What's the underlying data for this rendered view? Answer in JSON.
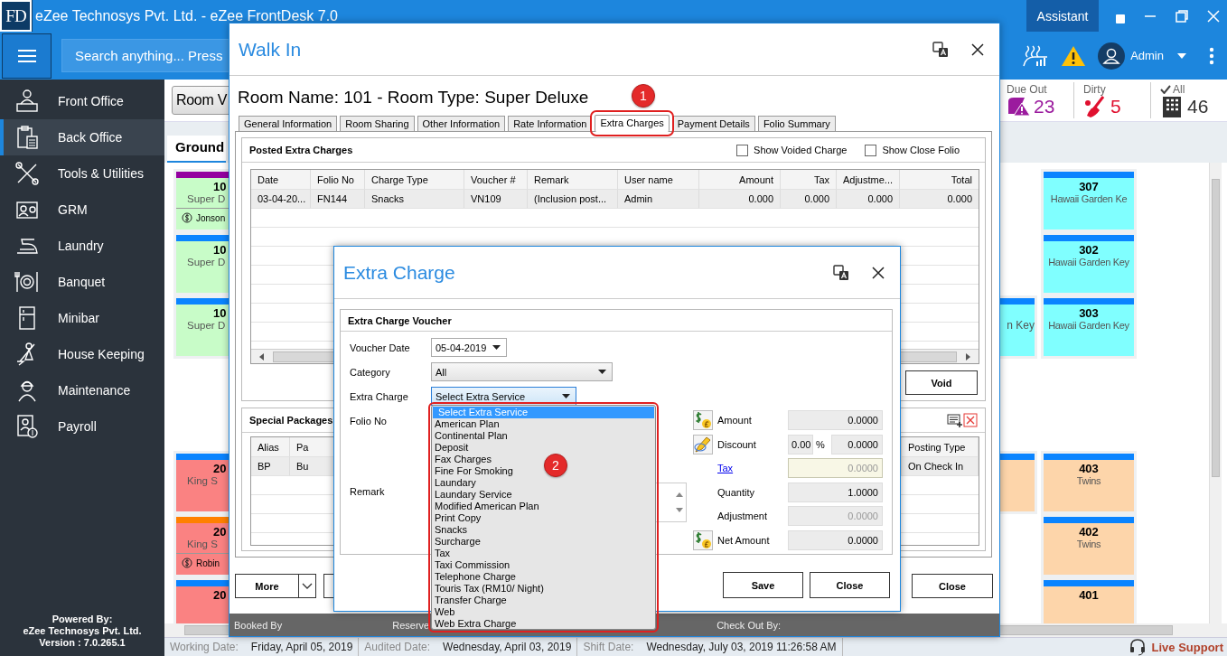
{
  "app": {
    "logo": "FD",
    "title": "eZee Technosys Pvt. Ltd. - eZee FrontDesk 7.0",
    "assistant": "Assistant"
  },
  "toolbar": {
    "search": {
      "placeholder": "Search anything... Press"
    },
    "user": "Admin"
  },
  "sidebar": {
    "items": [
      {
        "label": "Front Office",
        "selected": false
      },
      {
        "label": "Back Office",
        "selected": true
      },
      {
        "label": "Tools & Utilities",
        "selected": false
      },
      {
        "label": "GRM",
        "selected": false
      },
      {
        "label": "Laundry",
        "selected": false
      },
      {
        "label": "Banquet",
        "selected": false
      },
      {
        "label": "Minibar",
        "selected": false
      },
      {
        "label": "House Keeping",
        "selected": false
      },
      {
        "label": "Maintenance",
        "selected": false
      },
      {
        "label": "Payroll",
        "selected": false
      }
    ],
    "footer": [
      "Powered By:",
      "eZee Technosys Pvt. Ltd.",
      "Version : 7.0.265.1"
    ]
  },
  "room_view": {
    "view_button": "Room V",
    "stats": [
      {
        "kind": "due_out",
        "label": "Due Out",
        "value": "23",
        "color": "#9b1b9e"
      },
      {
        "kind": "dirty",
        "label": "Dirty",
        "value": "5",
        "color": "#e0102f"
      },
      {
        "kind": "all",
        "label": "All",
        "value": "46",
        "color": "#333333"
      }
    ],
    "floor_tabs": [
      {
        "label": "Ground",
        "selected": true
      }
    ],
    "rows": [
      {
        "cells": [
          {
            "number": "10",
            "type": "Super D",
            "guest": "Jonson",
            "color": "#c8fcc8",
            "strip": {
              "color": "#9400a0"
            }
          },
          null,
          {
            "number": "307",
            "type": "Hawaii Garden Ke",
            "color": "#80ffff",
            "strip": {
              "color": "#0a84ff"
            }
          }
        ]
      },
      {
        "cells": [
          {
            "number": "10",
            "type": "Super D",
            "color": "#c8fcc8",
            "strip": {
              "color": "#0a84ff"
            }
          },
          null,
          {
            "number": "302",
            "type": "Hawaii Garden Key",
            "color": "#80ffff",
            "strip": {
              "color": "#0a84ff"
            }
          }
        ]
      },
      {
        "cells": [
          {
            "number": "10",
            "type": "Super D",
            "color": "#c8fcc8",
            "strip": {
              "color": "#0a84ff"
            }
          },
          {
            "type": "n Key",
            "color": "#80ffff",
            "strip": {
              "color": "#0a84ff"
            }
          },
          {
            "number": "303",
            "type": "Hawaii Garden Key",
            "color": "#80ffff",
            "strip": {
              "color": "#0a84ff"
            }
          }
        ]
      },
      {
        "cells": [
          null,
          null,
          null
        ]
      },
      {
        "cells": [
          null,
          null,
          null
        ]
      },
      {
        "cells": [
          {
            "number": "20",
            "type": "King S",
            "color": "#fa8282",
            "strip": {
              "color": "#0a84ff"
            }
          },
          {
            "color": "#fdd5aa",
            "strip": {
              "color": "#0a84ff"
            }
          },
          {
            "number": "403",
            "type": "Twins",
            "color": "#fdd5aa",
            "strip": {
              "color": "#0a84ff"
            }
          }
        ]
      },
      {
        "cells": [
          {
            "number": "20",
            "type": "King S",
            "guest": "Robin",
            "color": "#fa8282",
            "strip": {
              "color": "#ff8000"
            }
          },
          null,
          {
            "number": "402",
            "type": "Twins",
            "color": "#fdd5aa",
            "strip": {
              "color": "#0a84ff"
            }
          }
        ]
      },
      {
        "cells": [
          {
            "number": "20",
            "color": "#fa8282",
            "strip": {
              "color": "#0a84ff"
            }
          },
          null,
          {
            "number": "401",
            "color": "#fdd5aa",
            "strip": {
              "color": "#0a84ff"
            }
          }
        ]
      }
    ]
  },
  "status_bar": {
    "items": [
      {
        "label": "Working Date:",
        "value": "Friday, April 05, 2019"
      },
      {
        "label": "Audited Date:",
        "value": "Wednesday, April 03, 2019"
      },
      {
        "label": "Shift Date:",
        "value": "Wednesday, July 03, 2019 11:26:58 AM"
      }
    ],
    "support": "Live Support"
  },
  "walk_in": {
    "title": "Walk In",
    "heading": "Room Name: 101 - Room Type: Super Deluxe",
    "tabs": [
      {
        "label": "General Information",
        "selected": false,
        "highlighted": false
      },
      {
        "label": "Room Sharing",
        "selected": false,
        "highlighted": false
      },
      {
        "label": "Other Information",
        "selected": false,
        "highlighted": false
      },
      {
        "label": "Rate Information",
        "selected": false,
        "highlighted": false
      },
      {
        "label": "Extra Charges",
        "selected": true,
        "highlighted": true
      },
      {
        "label": "Payment Details",
        "selected": false,
        "highlighted": false
      },
      {
        "label": "Folio Summary",
        "selected": false,
        "highlighted": false
      }
    ],
    "callout": "1",
    "posted": {
      "title": "Posted Extra Charges",
      "options": [
        {
          "label": "Show Voided Charge",
          "checked": false
        },
        {
          "label": "Show Close Folio",
          "checked": false
        }
      ],
      "columns": [
        "Date",
        "Folio No",
        "Charge Type",
        "Voucher #",
        "Remark",
        "User name",
        "Amount",
        "Tax",
        "Adjustme...",
        "Total"
      ],
      "rows": [
        [
          "03-04-20...",
          "FN144",
          "Snacks",
          "VN109",
          "(Inclusion post...",
          "Admin",
          "0.000",
          "0.000",
          "0.000",
          "0.000"
        ]
      ],
      "void": "Void"
    },
    "packages": {
      "title": "Special Packages",
      "columns": [
        "Alias",
        "Pa",
        "Posting Type"
      ],
      "rows": [
        [
          "BP",
          "Bu",
          "On Check In"
        ]
      ]
    },
    "buttons": {
      "more": "More",
      "close": "Close"
    },
    "footer": [
      "Booked By",
      "Reserve",
      "Check Out By:"
    ]
  },
  "extra_charge": {
    "title": "Extra Charge",
    "group": "Extra Charge Voucher",
    "fields": [
      {
        "kind": "date",
        "label": "Voucher Date",
        "value": "05-04-2019",
        "focused": false
      },
      {
        "kind": "combo",
        "label": "Category",
        "value": "All",
        "focused": false
      },
      {
        "kind": "combo",
        "label": "Extra Charge",
        "value": "Select Extra Service",
        "focused": true
      },
      {
        "kind": "label",
        "label": "Folio No"
      },
      {
        "kind": "memo",
        "label": "Remark"
      }
    ],
    "amounts": [
      {
        "kind": "money",
        "label": "Amount",
        "value": "0.0000",
        "disabled": false
      },
      {
        "kind": "discount",
        "label": "Discount",
        "percent": "0.00",
        "symbol": "%",
        "value": "0.0000",
        "disabled": false
      },
      {
        "kind": "link",
        "label": "Tax",
        "value": "0.0000",
        "disabled": true
      },
      {
        "kind": "plain",
        "label": "Quantity",
        "value": "1.0000",
        "disabled": false
      },
      {
        "kind": "plain",
        "label": "Adjustment",
        "value": "0.0000",
        "disabled": true
      },
      {
        "kind": "money",
        "label": "Net Amount",
        "value": "0.0000",
        "disabled": false
      }
    ],
    "buttons": [
      "Save",
      "Close"
    ],
    "dropdown": {
      "highlighted": true,
      "items": [
        {
          "label": "Select Extra Service",
          "selected": true
        },
        {
          "label": "American Plan",
          "selected": false
        },
        {
          "label": "Continental Plan",
          "selected": false
        },
        {
          "label": "Deposit",
          "selected": false
        },
        {
          "label": "Fax Charges",
          "selected": false
        },
        {
          "label": "Fine For Smoking",
          "selected": false
        },
        {
          "label": "Laundary",
          "selected": false
        },
        {
          "label": "Laundary Service",
          "selected": false
        },
        {
          "label": "Modified American Plan",
          "selected": false
        },
        {
          "label": "Print Copy",
          "selected": false
        },
        {
          "label": "Snacks",
          "selected": false
        },
        {
          "label": "Surcharge",
          "selected": false
        },
        {
          "label": "Tax",
          "selected": false
        },
        {
          "label": "Taxi Commission",
          "selected": false
        },
        {
          "label": "Telephone Charge",
          "selected": false
        },
        {
          "label": "Touris Tax (RM10/ Night)",
          "selected": false
        },
        {
          "label": "Transfer Charge",
          "selected": false
        },
        {
          "label": "Web",
          "selected": false
        },
        {
          "label": "Web Extra Charge",
          "selected": false
        }
      ]
    },
    "callout": "2"
  }
}
